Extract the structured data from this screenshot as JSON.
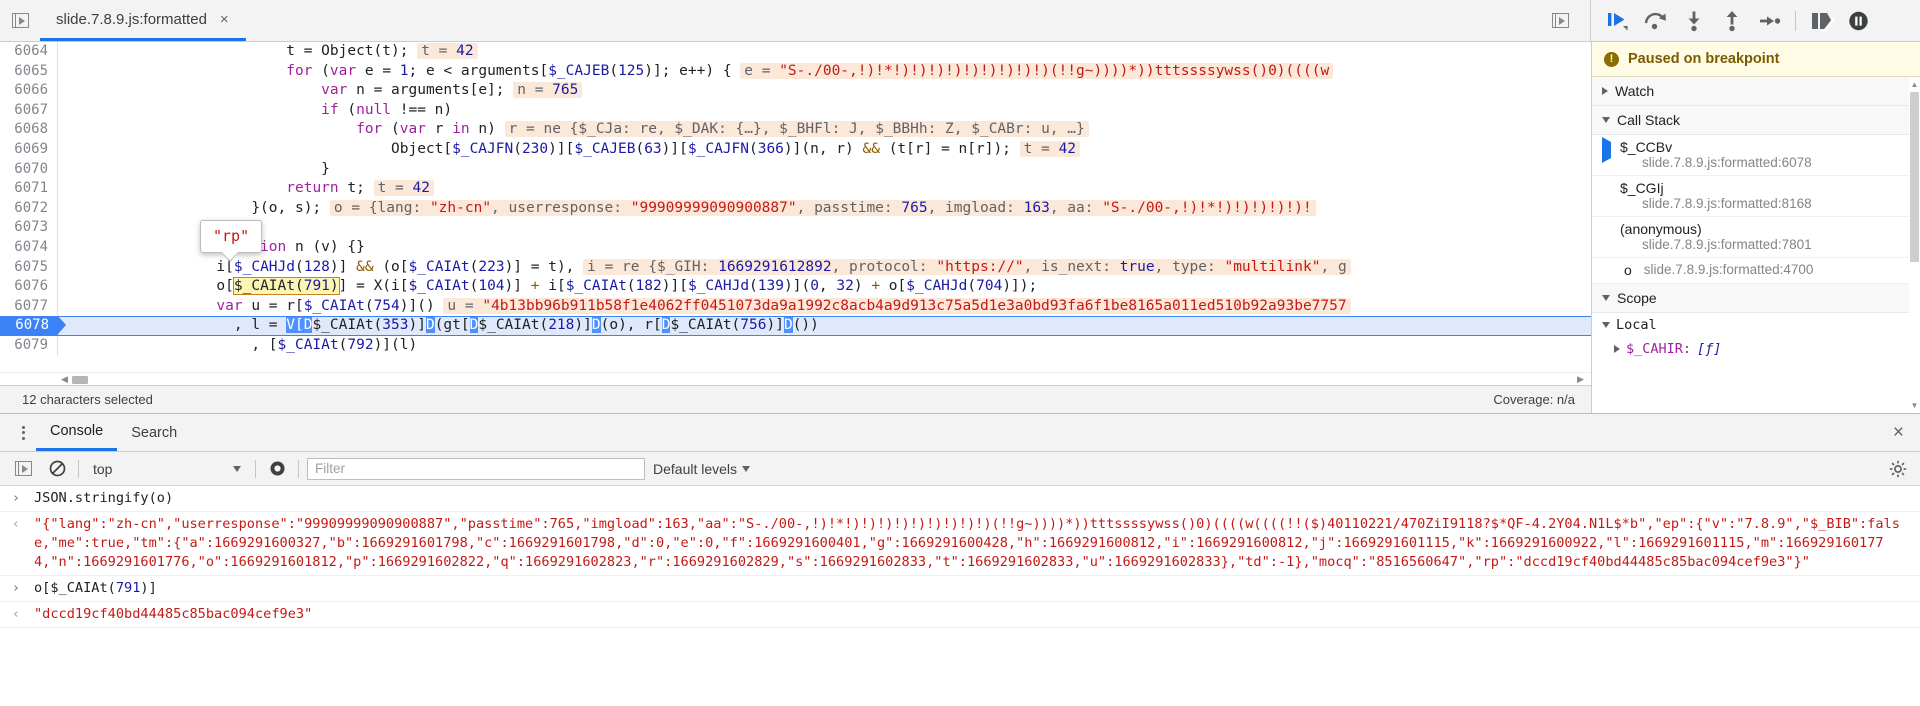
{
  "window": {
    "tab_label": "slide.7.8.9.js:formatted",
    "tab_close": "×",
    "panel_toggle_icon": "show-navigator-icon",
    "right_toggle_icon": "show-debugger-icon"
  },
  "debug_toolbar": {
    "buttons": [
      {
        "name": "resume-script-execution",
        "label": "Resume script execution"
      },
      {
        "name": "step-over-next-function-call",
        "label": "Step over next function call"
      },
      {
        "name": "step-into-next-function-call",
        "label": "Step into next function call"
      },
      {
        "name": "step-out-of-current-function",
        "label": "Step out of current function"
      },
      {
        "name": "step",
        "label": "Step"
      },
      {
        "name": "deactivate-breakpoints",
        "label": "Deactivate breakpoints"
      },
      {
        "name": "pause-on-exceptions",
        "label": "Pause on exceptions"
      }
    ]
  },
  "editor": {
    "first_line_number": 6064,
    "exec_line": 6078,
    "tooltip_value": "\"rp\"",
    "lines": [
      {
        "num": "6064",
        "html": "                         t = Object(t); <span class=\"vhint\"><span class=\"vk\">t = </span><span class=\"vn\">42</span></span>"
      },
      {
        "num": "6065",
        "html": "                         <span class=\"kw\">for</span> (<span class=\"kw\">var</span> e = <span class=\"num\">1</span>; e &lt; arguments[<span class=\"blue\">$_CAJEB</span>(<span class=\"num\">125</span>)]; e++) { <span class=\"vhint\"><span class=\"vk\">e = </span><span class=\"vs\">\"S-./00-,!)!*!)!)!)!)!)!)!)!)!)(!!g~))))*))tttssssywss()0)((((w</span></span>"
      },
      {
        "num": "6066",
        "html": "                             <span class=\"kw\">var</span> n = arguments[e]; <span class=\"vhint\"><span class=\"vk\">n = </span><span class=\"vn\">765</span></span>"
      },
      {
        "num": "6067",
        "html": "                             <span class=\"kw\">if</span> (<span class=\"kw\">null</span> !== n)"
      },
      {
        "num": "6068",
        "html": "                                 <span class=\"kw\">for</span> (<span class=\"kw\">var</span> r <span class=\"kw\">in</span> n) <span class=\"vhint\"><span class=\"vk\">r = ne {$_CJa: re, $_DAK: {…}, $_BHFl: J, $_BBHh: Z, $_CABr: u, …}</span></span>"
      },
      {
        "num": "6069",
        "html": "                                     Object[<span class=\"blue\">$_CAJFN</span>(<span class=\"num\">230</span>)][<span class=\"blue\">$_CAJEB</span>(<span class=\"num\">63</span>)][<span class=\"blue\">$_CAJFN</span>(<span class=\"num\">366</span>)](n, r) <span class=\"op\">&amp;&amp;</span> (t[r] = n[r]); <span class=\"vhint\"><span class=\"vk\">t = </span><span class=\"vn\">42</span></span>"
      },
      {
        "num": "6070",
        "html": "                             }"
      },
      {
        "num": "6071",
        "html": "                         <span class=\"kw\">return</span> t; <span class=\"vhint\"><span class=\"vk\">t = </span><span class=\"vn\">42</span></span>"
      },
      {
        "num": "6072",
        "html": "                     }(o, s); <span class=\"vhint\"><span class=\"vk\">o = {lang: </span><span class=\"vs\">\"zh-cn\"</span><span class=\"vk\">, userresponse: </span><span class=\"vs\">\"99909999090900887\"</span><span class=\"vk\">, passtime: </span><span class=\"vn\">765</span><span class=\"vk\">, imgload: </span><span class=\"vn\">163</span><span class=\"vk\">, aa: </span><span class=\"vs\">\"S-./00-,!)!*!)!)!)!)!)!</span></span>"
      },
      {
        "num": "6073",
        "html": "                 }"
      },
      {
        "num": "6074",
        "html": "                 <span class=\"kw\">function</span> n (v) {}"
      },
      {
        "num": "6075",
        "html": "                 i[<span class=\"blue\">$_CAHJd</span>(<span class=\"num\">128</span>)] <span class=\"op\">&amp;&amp;</span> (o[<span class=\"blue\">$_CAIAt</span>(<span class=\"num\">223</span>)] = t), <span class=\"vhint\"><span class=\"vk\">i = re {$_GIH: </span><span class=\"vn\">1669291612892</span><span class=\"vk\">, protocol: </span><span class=\"vs\">\"https://\"</span><span class=\"vk\">, is_next: </span><span class=\"vn\">true</span><span class=\"vk\">, type: </span><span class=\"vs\">\"multilink\"</span><span class=\"vk\">, g</span></span>"
      },
      {
        "num": "6076",
        "html": "                 o[<span class=\"sel-token\">$_CAIAt(<span class=\"num\">791</span>)</span>] = X(i[<span class=\"blue\">$_CAIAt</span>(<span class=\"num\">104</span>)] <span class=\"op\">+</span> i[<span class=\"blue\">$_CAIAt</span>(<span class=\"num\">182</span>)][<span class=\"blue\">$_CAHJd</span>(<span class=\"num\">139</span>)](<span class=\"num\">0</span>, <span class=\"num\">32</span>) <span class=\"op\">+</span> o[<span class=\"blue\">$_CAHJd</span>(<span class=\"num\">704</span>)]);"
      },
      {
        "num": "6077",
        "html": "                 <span class=\"kw\">var</span> u = r[<span class=\"blue\">$_CAIAt</span>(<span class=\"num\">754</span>)]() <span class=\"vhint\"><span class=\"vk\">u = </span><span class=\"vs\">\"4b13bb96b911b58f1e4062ff0451073da9a1992c8acb4a9d913c75a5d1e3a0bd93fa6f1be8165a011ed510b92a93be7757</span></span>"
      },
      {
        "num": "6078",
        "html": "                   , l = <span class=\"selbox\">V[</span><span class=\"selbox\">D</span>$_CAIAt(<span class=\"num\">353</span>)]<span class=\"selbox\">D</span>(gt[<span class=\"selbox\">D</span>$_CAIAt(<span class=\"num\">218</span>)]<span class=\"selbox\">D</span>(o), r[<span class=\"selbox\">D</span>$_CAIAt(<span class=\"num\">756</span>)]<span class=\"selbox\">D</span>())"
      },
      {
        "num": "6079",
        "html": "                     , [<span class=\"blue\">$_CAIAt</span>(<span class=\"num\">792</span>)](l)"
      }
    ]
  },
  "status": {
    "selection_text": "12 characters selected",
    "coverage_text": "Coverage: n/a"
  },
  "sidebar": {
    "paused_text": "Paused on breakpoint",
    "sections": [
      {
        "name": "watch",
        "label": "Watch",
        "expanded": false
      },
      {
        "name": "call-stack",
        "label": "Call Stack",
        "expanded": true
      },
      {
        "name": "scope",
        "label": "Scope",
        "expanded": true
      }
    ],
    "call_stack": [
      {
        "fn": "$_CCBv",
        "loc": "slide.7.8.9.js:formatted:6078",
        "active": true,
        "inline": false
      },
      {
        "fn": "$_CGIj",
        "loc": "slide.7.8.9.js:formatted:8168",
        "active": false,
        "inline": false
      },
      {
        "fn": "(anonymous)",
        "loc": "slide.7.8.9.js:formatted:7801",
        "active": false,
        "inline": false
      },
      {
        "fn": "o",
        "loc": "slide.7.8.9.js:formatted:4700",
        "active": false,
        "inline": true
      }
    ],
    "scope": {
      "group_label": "Local",
      "entries": [
        {
          "key": "$_CAHIR:",
          "value": "[ƒ]"
        }
      ]
    }
  },
  "drawer": {
    "tabs": [
      {
        "name": "console",
        "label": "Console",
        "active": true
      },
      {
        "name": "search",
        "label": "Search",
        "active": false
      }
    ],
    "close_label": "×",
    "toolbar": {
      "context_value": "top",
      "filter_placeholder": "Filter",
      "filter_value": "",
      "levels_label": "Default levels",
      "icons": [
        "toggle-console-sidebar-icon",
        "clear-console-icon",
        "live-expression-icon",
        "console-settings-icon"
      ]
    },
    "entries": [
      {
        "type": "input",
        "marker": "›",
        "html": "JSON.stringify(o)"
      },
      {
        "type": "output",
        "marker": "‹",
        "text": "\"{\"lang\":\"zh-cn\",\"userresponse\":\"99909999090900887\",\"passtime\":765,\"imgload\":163,\"aa\":\"S-./00-,!)!*!)!)!)!)!)!)!)!)!)(!!g~))))*))tttssssywss()0)((((w((((!!($)40110221/470ZiI9118?$*QF-4.2Y04.N1L$*b\",\"ep\":{\"v\":\"7.8.9\",\"$_BIB\":false,\"me\":true,\"tm\":{\"a\":1669291600327,\"b\":1669291601798,\"c\":1669291601798,\"d\":0,\"e\":0,\"f\":1669291600401,\"g\":1669291600428,\"h\":1669291600812,\"i\":1669291600812,\"j\":1669291601115,\"k\":1669291600922,\"l\":1669291601115,\"m\":1669291601774,\"n\":1669291601776,\"o\":1669291601812,\"p\":1669291602822,\"q\":1669291602823,\"r\":1669291602829,\"s\":1669291602833,\"t\":1669291602833,\"u\":1669291602833},\"td\":-1},\"mocq\":\"8516560647\",\"rp\":\"dccd19cf40bd44485c85bac094cef9e3\"}\""
      },
      {
        "type": "input",
        "marker": "›",
        "html": "o[$_CAIAt(<span class=\"n\">791</span>)]"
      },
      {
        "type": "output",
        "marker": "‹",
        "text": "\"dccd19cf40bd44485c85bac094cef9e3\""
      }
    ]
  },
  "colors": {
    "accent": "#1a73e8",
    "exec_line_bg": "#dfe9fb",
    "value_hint_bg": "#fce8d8",
    "selection_yellow": "#fdf6b2",
    "paused_banner_bg": "#fffbe5",
    "string_red": "#c41a16",
    "keyword_purple": "#a020a0",
    "number_blue": "#1a1aa6"
  }
}
